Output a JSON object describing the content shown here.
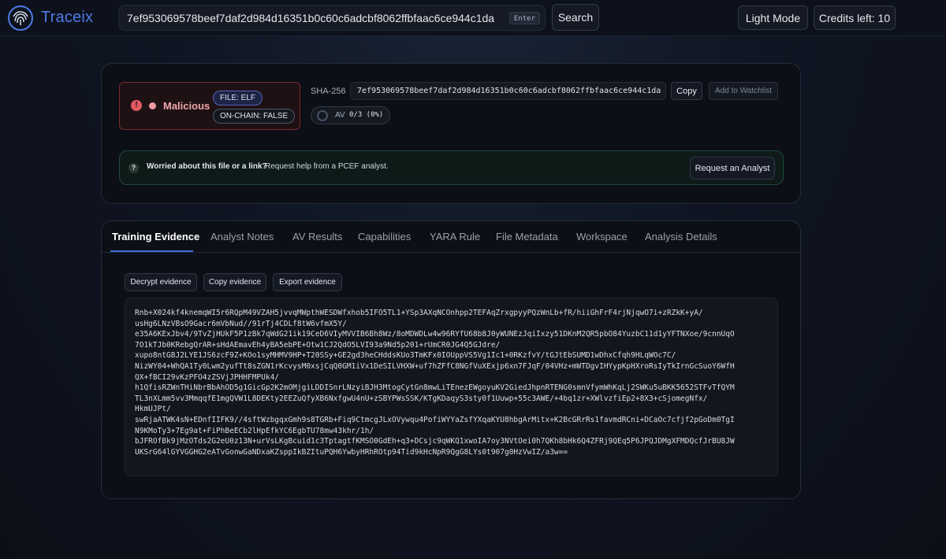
{
  "header": {
    "brand": "Traceix",
    "search": {
      "value": "7ef953069578beef7daf2d984d16351b0c60c6adcbf8062ffbfaac6ce944c1da",
      "hint": "Enter"
    },
    "search_button": "Search",
    "theme_button": "Light Mode",
    "credits_button": "Credits left: 10"
  },
  "summary": {
    "verdict": "Malicious",
    "file_chip": "FILE: ELF",
    "chain_chip": "ON-CHAIN: FALSE",
    "sha_label": "SHA-256",
    "sha_value": "7ef953069578beef7daf2d984d16351b0c60c6adcbf8062ffbfaac6ce944c1da",
    "copy_button": "Copy",
    "watchlist_button": "Add to Watchlist",
    "av_label": "AV",
    "av_value": "0/3 (0%)",
    "help_bold": "Worried about this file or a link?",
    "help_text": "Request help from a PCEF analyst.",
    "analyst_button": "Request an Analyst",
    "colors": {
      "malicious": "#e05a62",
      "accent": "#3d6fe0"
    }
  },
  "tabs": [
    {
      "label": "Training Evidence",
      "active": true
    },
    {
      "label": "Analyst Notes"
    },
    {
      "label": "AV Results"
    },
    {
      "label": "Capabilities"
    },
    {
      "label": "YARA Rule"
    },
    {
      "label": "File Metadata"
    },
    {
      "label": "Workspace"
    },
    {
      "label": "Analysis Details"
    }
  ],
  "evidence": {
    "decrypt_button": "Decrypt evidence",
    "copy_button": "Copy evidence",
    "export_button": "Export evidence",
    "lines": [
      "Rnb+X024kf4knemqWI5r6RQpM49VZAH5jvvqMWpthWESDWfxhob5IFO5TL1+YSp3AXqNCOnhpp2TEFAqZrxgpyyPQzWnLb+fR/hiiGhFrF4rjNjqwO7i+zRZkK+yA/",
      "usHg6LNzVBsO9Gacr6mVbNud//91rTj4CDLf8tW6vfmX5Y/",
      "e35A6KExJbv4/9TvZjHUkF5P1zBk7qWdG21ik19CeD6VIyMVVIB6Bh8Wz/8oMDWDLw4w96RYfU68b8J0yWUNEzJqiIxzy51DKnM2QR5pbO84YuzbC11d1yYFTNXoe/9cnnUqO",
      "7O1kTJb0KRebgQrAR+sHdAEmavEh4yBA5ebPE+Otw1CJ2QdO5LVI93a9Nd5p201+rUmCR0JG4Q5GJdre/",
      "xupo8ntGBJ2LYE1JS6zcF9Z+KOo1syMHMV9HP+T20SSy+GE2gd3heCHddsKUo3TmKFx0IOUppVS5Vg1Ic1+0RKzfvY/tGJtEbSUMD1wDhxCfqh9HLqWOc7C/",
      "NizWY04+WhQA1Ty0Lwm2yufTt8sZGN1rKcvysM0xsjCqQ0GM1iVx1DeSILVHXW+uf7hZFfC8NGfVuXExjp6xn7FJqF/04VHz+mWTDgvIHYypKpHXroRsIyTkIrnGcSuoY6WfH",
      "QX+fBCI29vKzPFO4zZSVjJPHHFMPUk4/",
      "h1QfisRZWnTHiNbrBbAhOD5g1GicGp2K2mOMjgiLDDISnrLNzyiBJH3MtogCytGn8mwLiTEnezEWgoyuKV2GiedJhpnRTENG0smnVfymWhKqLj2SWKu5uBKK5652STFvTfQYM",
      "TL3nXLmm5vv3MmqqfE1mgQVW1L8DEKty2EEZuQfyXB6NxfgwU4nU+zSBYPWsSSK/KTgKDaqyS3sty0f1Uuwp+55c3AWE/+4bq1zr+XWlvzfiEp2+8X3+cSjomegNfx/",
      "HkmUJPt/",
      "swRjaATWK4sN+EDnfIIFK9//4sftWzbgqxGmh9s8TGRb+Fiq9CtmcgJLxOVywqu4PofiWYYaZsfYXqaKYU8hbgArMitx+K2BcGRrRs1favmdRCni+DCaOc7cfjf2pGoDm0TgI",
      "N9KMoTy3+7Eg9at+FiPhBeECb2lHpEfkYC6EgbTU78mw43khr/1h/",
      "bJFROfBk9jMzOTds2G2eU0z13N+urVsLKgBcuid1c3TptagtfKMSO0GdEh+q3+DCsjc9qWKQ1xwoIA7oy3NVtOei0h7QKh8bHk6Q4ZFRj9QEq5P6JPQJDMgXFMDQcfJrBU8JW",
      "UKSrG64lGYVGGHG2eATvGonwGaNDxaKZsppIkBZItuPQH6YwbyHRhROtp94Tid9kHcNpR9QgG8LYs0t907g0HzVwIZ/a3w=="
    ]
  }
}
